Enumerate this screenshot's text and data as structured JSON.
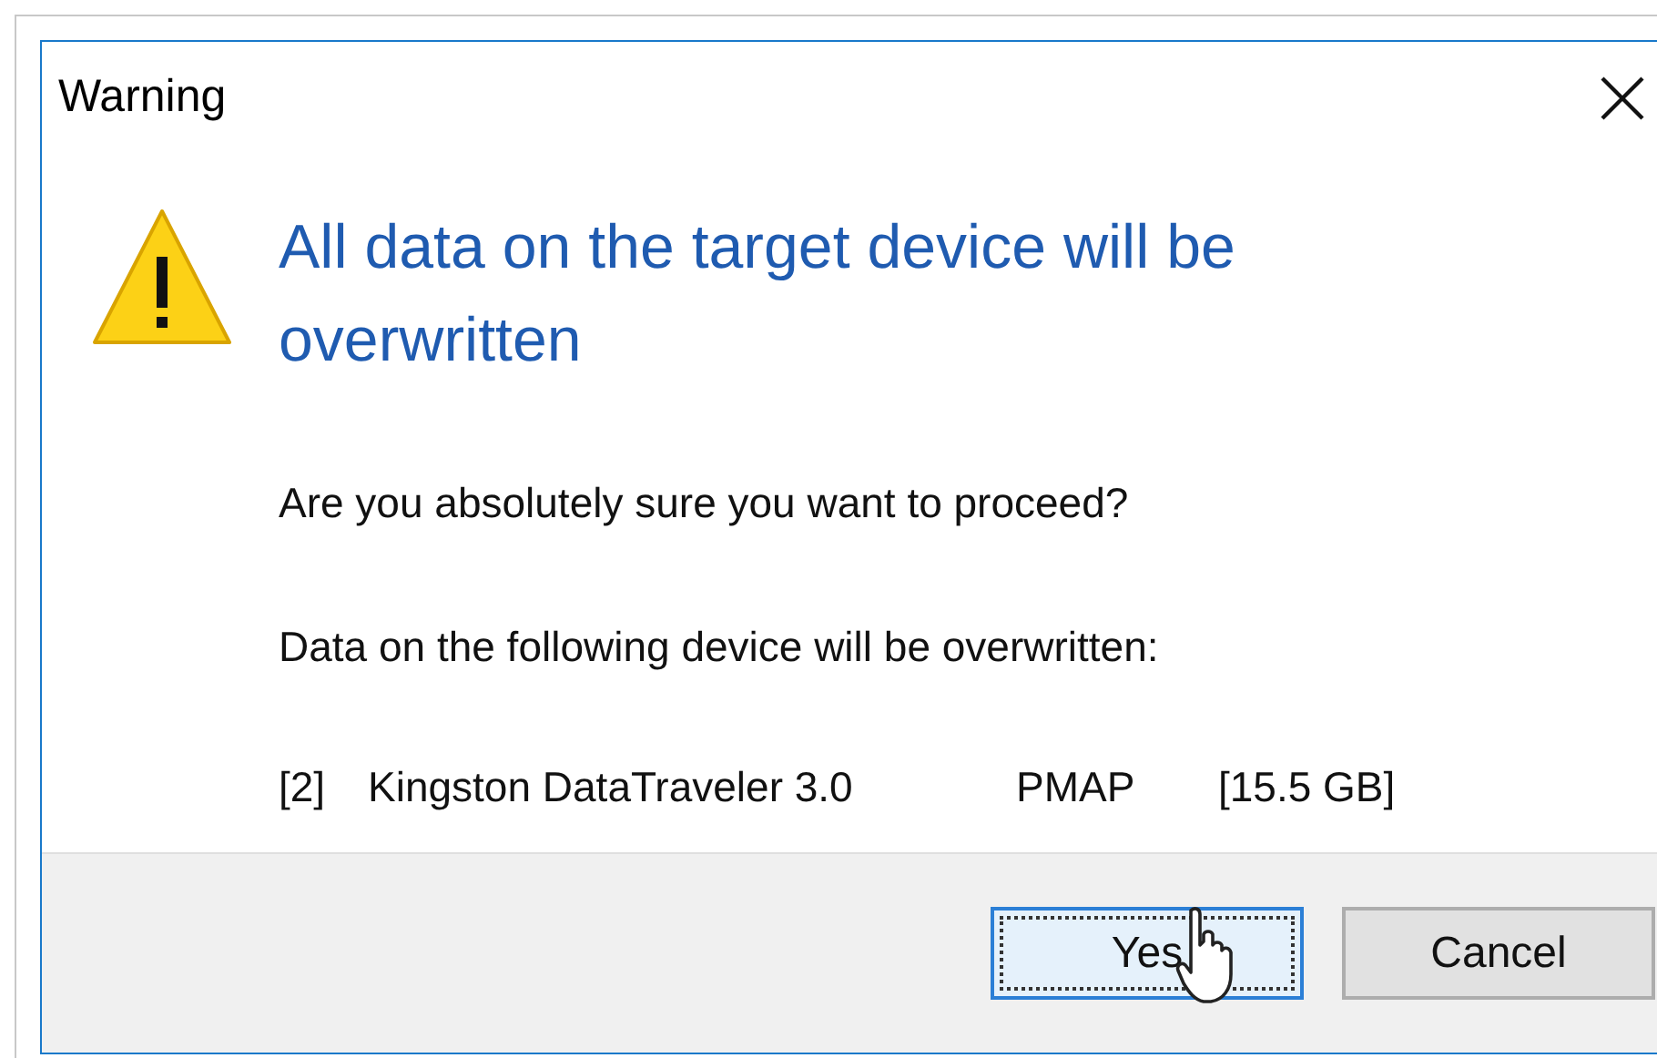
{
  "window": {
    "title": "Warning"
  },
  "heading": "All data on the target device will be overwritten",
  "question": "Are you absolutely sure you want to proceed?",
  "notice": "Data on the following device will be overwritten:",
  "device": [
    "[2]",
    "Kingston DataTraveler 3.0",
    "PMAP",
    "[15.5 GB]"
  ],
  "buttons": [
    {
      "label": "Yes",
      "default": true
    },
    {
      "label": "Cancel",
      "default": false
    }
  ]
}
